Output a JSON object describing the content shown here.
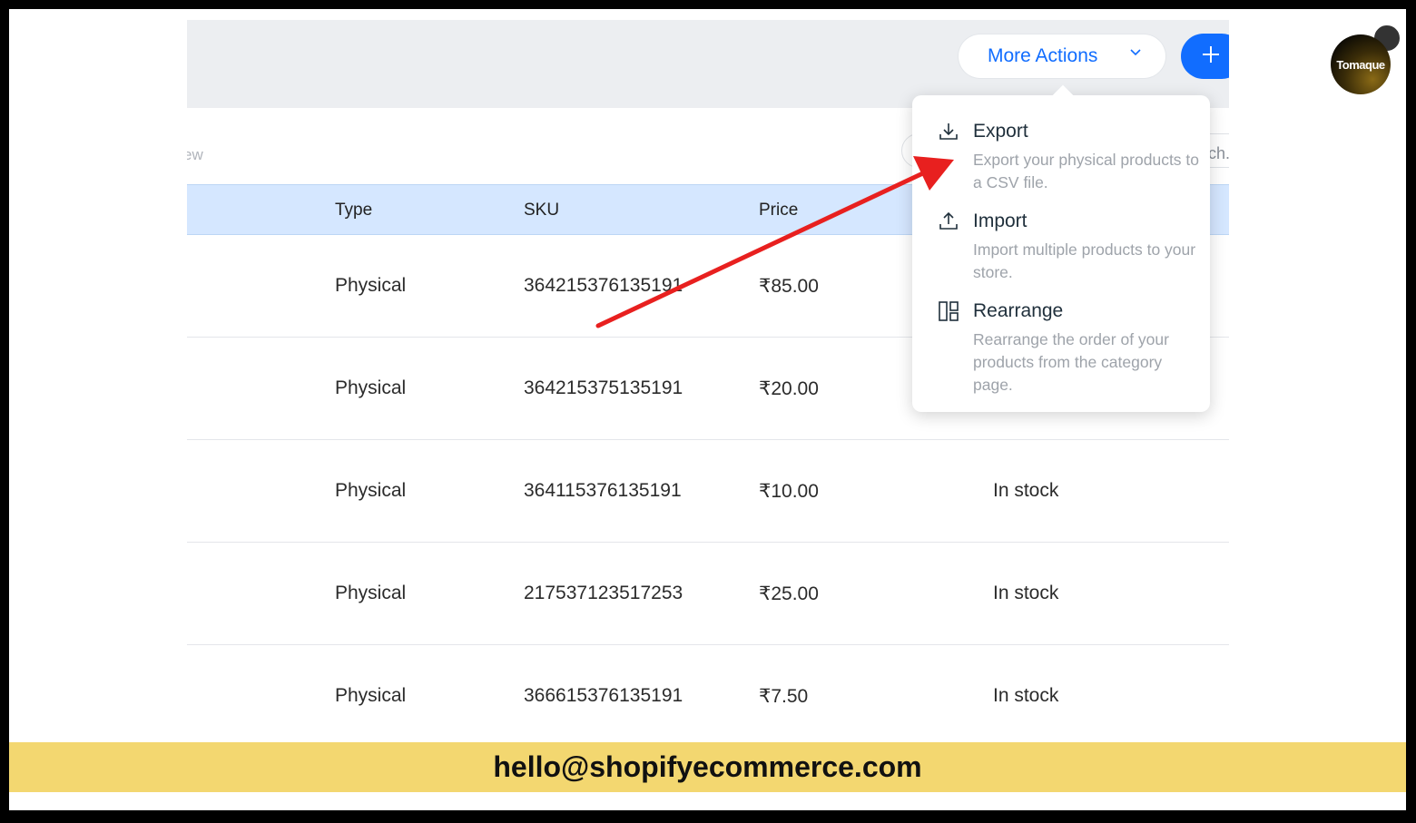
{
  "toolbar": {
    "more_actions_label": "More Actions",
    "add_icon": "plus-icon"
  },
  "filters": {
    "view_fragment": "ew",
    "search_fragment": "ch."
  },
  "table": {
    "columns": [
      "Type",
      "SKU",
      "Price"
    ],
    "rows": [
      {
        "type": "Physical",
        "sku": "364215376135191",
        "price": "₹85.00",
        "inventory": ""
      },
      {
        "type": "Physical",
        "sku": "364215375135191",
        "price": "₹20.00",
        "inventory": ""
      },
      {
        "type": "Physical",
        "sku": "364115376135191",
        "price": "₹10.00",
        "inventory": "In stock"
      },
      {
        "type": "Physical",
        "sku": "217537123517253",
        "price": "₹25.00",
        "inventory": "In stock"
      },
      {
        "type": "Physical",
        "sku": "366615376135191",
        "price": "₹7.50",
        "inventory": "In stock"
      }
    ]
  },
  "dropdown": {
    "items": [
      {
        "title": "Export",
        "description": "Export your physical products to a CSV file.",
        "icon": "download-icon"
      },
      {
        "title": "Import",
        "description": "Import multiple products to your store.",
        "icon": "upload-icon"
      },
      {
        "title": "Rearrange",
        "description": "Rearrange the order of your products from the category page.",
        "icon": "rearrange-icon"
      }
    ]
  },
  "annotation": {
    "arrow_color": "#e8201f"
  },
  "brand": {
    "logo_text": "Tomaque"
  },
  "footer": {
    "email": "hello@shopifyecommerce.com"
  },
  "colors": {
    "accent": "#116dff",
    "header_bg": "#d5e7ff",
    "footer_bg": "#f3d770"
  }
}
